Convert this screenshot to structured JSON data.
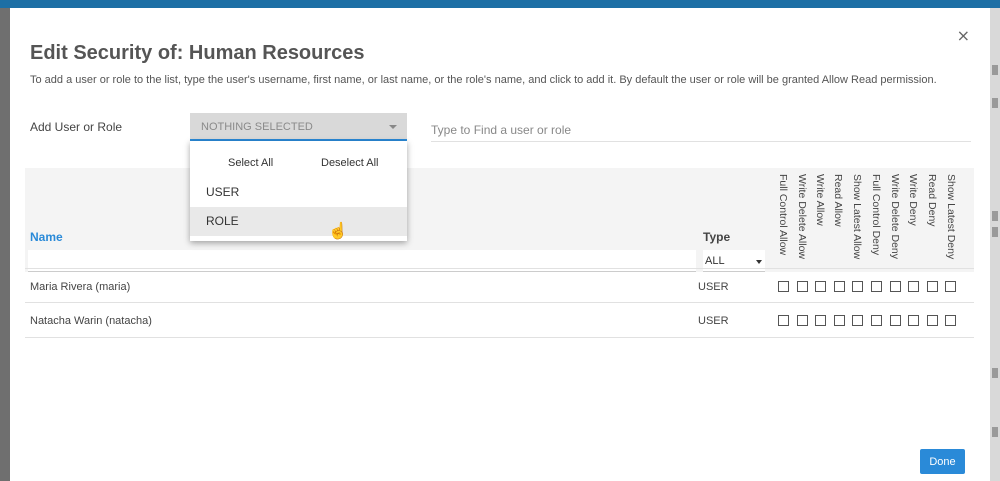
{
  "dialog": {
    "title": "Edit Security of: Human Resources",
    "description": "To add a user or role to the list, type the user's username, first name, or last name, or the role's name, and click to add it. By default the user or role will be granted Allow Read permission.",
    "close_label": "×"
  },
  "add": {
    "label": "Add User or Role",
    "select_value": "NOTHING SELECTED",
    "find_placeholder": "Type to Find a user or role"
  },
  "dropdown": {
    "select_all": "Select All",
    "deselect_all": "Deselect All",
    "options": [
      "USER",
      "ROLE"
    ],
    "hovered": "ROLE"
  },
  "table": {
    "name_header": "Name",
    "type_header": "Type",
    "type_filter": "ALL",
    "permissions": [
      "Full Control Allow",
      "Write Delete Allow",
      "Write Allow",
      "Read Allow",
      "Show Latest Allow",
      "Full Control Deny",
      "Write Delete Deny",
      "Write Deny",
      "Read Deny",
      "Show Latest Deny"
    ],
    "rows": [
      {
        "name": "Maria Rivera (maria)",
        "type": "USER",
        "checked": [
          false,
          false,
          false,
          false,
          false,
          false,
          false,
          false,
          false,
          false
        ]
      },
      {
        "name": "Natacha Warin (natacha)",
        "type": "USER",
        "checked": [
          false,
          false,
          false,
          false,
          false,
          false,
          false,
          false,
          false,
          false
        ]
      }
    ]
  },
  "footer": {
    "done_label": "Done"
  },
  "colors": {
    "accent": "#2a8ad8",
    "header_bar": "#1d6fa5",
    "overlay": "#6f6f6f"
  }
}
